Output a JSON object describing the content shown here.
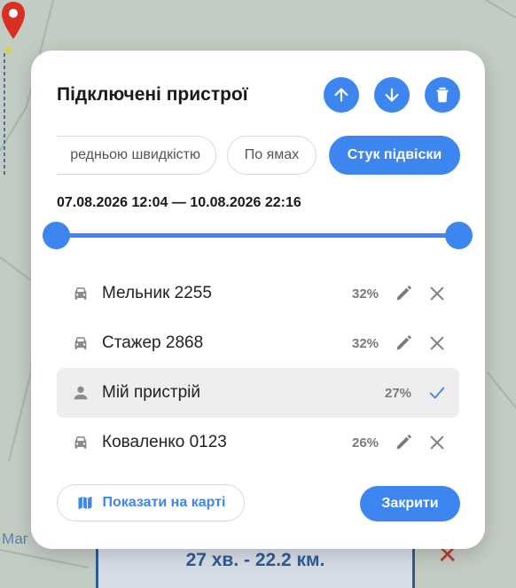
{
  "map": {
    "label_partial": "Маг",
    "route_summary": "27 хв. - 22.2 км.",
    "close_symbol": "✕"
  },
  "dialog": {
    "title": "Підключені пристрої",
    "header_actions": [
      {
        "icon": "arrow-up-icon"
      },
      {
        "icon": "arrow-down-icon"
      },
      {
        "icon": "trash-icon"
      }
    ],
    "filters": [
      {
        "label": "Середньою швидкістю",
        "visible_text": "редньою швидкістю",
        "active": false
      },
      {
        "label": "По ямах",
        "active": false
      },
      {
        "label": "Стук підвіски",
        "active": true
      }
    ],
    "date_range": "07.08.2026 12:04 — 10.08.2026 22:16",
    "slider": {
      "start": 0.0,
      "end": 1.0
    },
    "devices": [
      {
        "name": "Мельник 2255",
        "percent": "32%",
        "icon": "car-icon",
        "selected": false,
        "editable": true
      },
      {
        "name": "Стажер 2868",
        "percent": "32%",
        "icon": "car-icon",
        "selected": false,
        "editable": true
      },
      {
        "name": "Мій пристрій",
        "percent": "27%",
        "icon": "person-icon",
        "selected": true,
        "editable": false
      },
      {
        "name": "Коваленко 0123",
        "percent": "26%",
        "icon": "car-icon",
        "selected": false,
        "editable": true
      }
    ],
    "show_on_map_label": "Показати на карті",
    "close_label": "Закрити"
  },
  "colors": {
    "accent": "#3d86f0",
    "text": "#1a1a1a",
    "muted": "#7a7a7a"
  }
}
